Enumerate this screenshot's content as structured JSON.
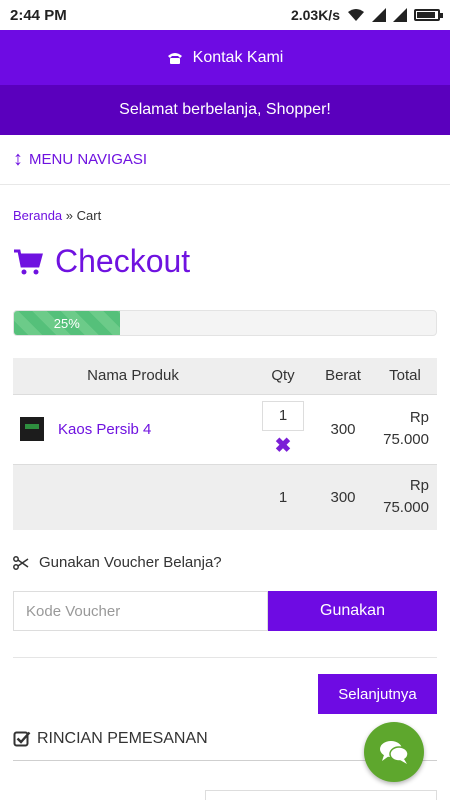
{
  "status_bar": {
    "time": "2:44 PM",
    "network_speed": "2.03K/s"
  },
  "header": {
    "contact_label": "Kontak Kami",
    "welcome_text": "Selamat berbelanja, Shopper!"
  },
  "menu": {
    "label": "MENU NAVIGASI"
  },
  "breadcrumb": {
    "home": "Beranda",
    "separator": "»",
    "current": "Cart"
  },
  "page": {
    "title": "Checkout"
  },
  "progress": {
    "label": "25%",
    "value": 0.25
  },
  "cart": {
    "headers": {
      "name": "Nama Produk",
      "qty": "Qty",
      "weight": "Berat",
      "total": "Total"
    },
    "items": [
      {
        "name": "Kaos Persib 4",
        "qty": "1",
        "weight": "300",
        "total_line1": "Rp",
        "total_line2": "75.000"
      }
    ],
    "summary": {
      "qty": "1",
      "weight": "300",
      "total_line1": "Rp",
      "total_line2": "75.000"
    }
  },
  "voucher": {
    "label": "Gunakan Voucher Belanja?",
    "placeholder": "Kode Voucher",
    "button": "Gunakan"
  },
  "next_button": "Selanjutnya",
  "section": {
    "order_details": "RINCIAN PEMESANAN"
  },
  "colors": {
    "primary": "#6e0be3",
    "primary_dark": "#5a00bd",
    "progress": "#55c07a",
    "chat": "#5ea72d"
  }
}
